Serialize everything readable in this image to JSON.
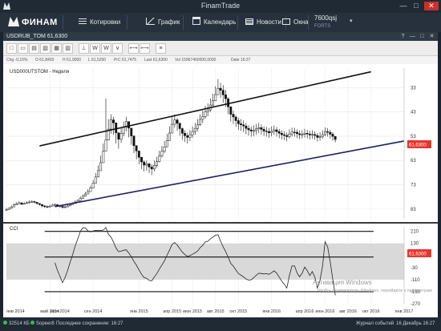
{
  "window": {
    "title": "FinamTrade",
    "minimize": "—",
    "maximize": "□",
    "close": "✕"
  },
  "toolbar": {
    "logo": "ФИНАМ",
    "items": [
      {
        "label": "Котировки",
        "icon": "quotes-icon"
      },
      {
        "label": "График",
        "icon": "chart-icon"
      },
      {
        "label": "Календарь",
        "icon": "calendar-icon"
      },
      {
        "label": "Новости",
        "icon": "news-icon"
      },
      {
        "label": "Окна",
        "icon": "windows-icon"
      }
    ],
    "account": {
      "id": "7600qsj",
      "sub": "FORTS"
    }
  },
  "chart_window": {
    "title": "USDRUB_TOM 61,6300",
    "buttons": [
      "?",
      "—",
      "□",
      "✕"
    ]
  },
  "chart_toolbar": {
    "buttons": [
      "□",
      "▭",
      "▤",
      "▧",
      "▦",
      "▥",
      "⊥",
      "W",
      "W",
      "∨",
      "⟷",
      "⟷",
      "≡"
    ]
  },
  "info_bar": {
    "chg": {
      "label": "Chg",
      "value": "-0,15%"
    },
    "open": {
      "label": "O",
      "value": "61,8400"
    },
    "high": {
      "label": "H",
      "value": "61,9000"
    },
    "low": {
      "label": "L",
      "value": "61,5250"
    },
    "prc": {
      "label": "PrC",
      "value": "61,7475"
    },
    "last": {
      "label": "Last",
      "value": "61,6300"
    },
    "vol": {
      "label": "Vol",
      "value": "15967460000,0000"
    },
    "date": {
      "label": "Date",
      "value": "16:27"
    }
  },
  "price_pane": {
    "legend": "USD000UTSTOM - Неделя",
    "y_ticks": [
      "83",
      "73",
      "63",
      "53",
      "43",
      "33"
    ],
    "last_price": "61,6300",
    "last_price_color": "#e8352c"
  },
  "cci_pane": {
    "label": "CCI",
    "y_ticks": [
      "210",
      "130",
      "50",
      "-30",
      "-110",
      "-190",
      "-270"
    ],
    "last_value": "61,6300"
  },
  "x_axis": {
    "labels": [
      "янв 2014",
      "май 2014",
      "июл 2014",
      "сен 2014",
      "янв 2015",
      "апр 2015",
      "июн 2015",
      "авг 2015",
      "окт 2015",
      "янв 2016",
      "апр 2016",
      "июн 2016",
      "авг 2016",
      "окт 2016",
      "янв 2017"
    ]
  },
  "watermark": {
    "line1": "Активация Windows",
    "line2": "Чтобы активировать Windows, перейдите к параметрам"
  },
  "status": {
    "memory": "32514 КБ",
    "connection": "Sopeer8",
    "saved": "Последнее сохранение: 16:27",
    "events": "Журнал событий",
    "datetime": "16 Декабрь 16:27"
  },
  "chart_data": [
    {
      "type": "candlestick",
      "title": "USD000UTSTOM - Неделя",
      "y_range": [
        29,
        91
      ],
      "x_range": [
        0,
        156
      ],
      "y_ticks": [
        33,
        43,
        53,
        63,
        73,
        83
      ],
      "x_tick_positions": [
        0,
        17,
        21,
        34,
        52,
        65,
        73,
        82,
        91,
        104,
        117,
        125,
        134,
        143,
        156
      ],
      "x_labels": [
        "янв 2014",
        "май 2014",
        "июл 2014",
        "сен 2014",
        "янв 2015",
        "апр 2015",
        "июн 2015",
        "авг 2015",
        "окт 2015",
        "янв 2016",
        "апр 2016",
        "июн 2016",
        "авг 2016",
        "окт 2016",
        "янв 2017"
      ],
      "close": [
        32.8,
        33.3,
        33.9,
        34.7,
        35.2,
        35.6,
        35.0,
        35.3,
        35.6,
        35.9,
        36.1,
        35.8,
        35.3,
        34.9,
        34.3,
        34.0,
        33.9,
        34.2,
        34.6,
        34.8,
        34.4,
        34.1,
        33.7,
        33.9,
        34.3,
        34.8,
        35.3,
        35.9,
        36.5,
        37.4,
        38.3,
        39.2,
        40.2,
        41.6,
        43.6,
        46.2,
        48.8,
        52.1,
        56.8,
        61.4,
        65.9,
        69.7,
        68.5,
        64.4,
        61.7,
        64.1,
        66.8,
        69.0,
        66.3,
        63.1,
        59.1,
        56.9,
        54.3,
        52.4,
        51.1,
        51.6,
        50.3,
        49.5,
        51.0,
        52.5,
        54.9,
        56.8,
        58.6,
        61.2,
        64.3,
        67.9,
        69.7,
        68.3,
        66.1,
        64.2,
        63.2,
        62.5,
        63.6,
        64.9,
        66.2,
        67.7,
        69.9,
        71.1,
        73.0,
        73.8,
        75.8,
        77.6,
        80.1,
        82.7,
        81.9,
        80.0,
        78.4,
        75.1,
        72.0,
        70.9,
        69.4,
        68.1,
        67.7,
        67.2,
        66.2,
        65.6,
        65.1,
        65.3,
        66.0,
        66.5,
        65.8,
        65.1,
        64.9,
        64.4,
        65.0,
        65.6,
        64.9,
        64.2,
        63.6,
        63.3,
        62.8,
        63.9,
        64.7,
        64.6,
        64.0,
        63.6,
        63.8,
        64.2,
        63.9,
        63.5,
        63.7,
        63.3,
        62.5,
        62.8,
        63.6,
        64.9,
        64.6,
        63.8,
        62.9,
        61.63
      ],
      "high": [
        33.5,
        33.8,
        34.5,
        35.3,
        35.8,
        36.1,
        35.6,
        35.8,
        36.2,
        36.6,
        36.7,
        36.4,
        35.9,
        35.5,
        34.9,
        34.6,
        34.5,
        34.8,
        35.2,
        35.4,
        35.0,
        34.7,
        34.3,
        34.5,
        34.9,
        35.4,
        35.9,
        36.5,
        37.2,
        38.2,
        39.1,
        40.1,
        41.2,
        42.6,
        45.0,
        47.8,
        51.0,
        55.0,
        60.0,
        78.5,
        70.0,
        72.0,
        71.0,
        67.0,
        64.5,
        66.5,
        69.0,
        71.0,
        68.5,
        65.5,
        61.5,
        59.0,
        56.5,
        54.5,
        53.0,
        53.0,
        52.0,
        51.5,
        53.0,
        54.5,
        57.0,
        59.0,
        61.0,
        64.0,
        67.0,
        71.0,
        72.0,
        70.5,
        68.5,
        66.5,
        65.5,
        64.5,
        65.5,
        67.0,
        68.5,
        70.0,
        72.0,
        73.5,
        75.5,
        76.5,
        78.5,
        80.5,
        83.5,
        86.5,
        85.0,
        84.0,
        82.0,
        79.0,
        75.0,
        73.5,
        71.5,
        70.5,
        70.0,
        69.5,
        68.5,
        67.5,
        67.0,
        67.5,
        68.0,
        68.5,
        67.8,
        67.0,
        66.8,
        66.4,
        67.0,
        67.4,
        66.8,
        66.0,
        65.4,
        65.0,
        64.5,
        65.8,
        66.5,
        66.4,
        65.8,
        65.4,
        65.5,
        66.0,
        65.6,
        65.2,
        65.4,
        65.0,
        64.2,
        64.6,
        65.4,
        66.6,
        66.3,
        65.6,
        64.6,
        63.0
      ],
      "low": [
        32.5,
        32.9,
        33.5,
        34.3,
        34.8,
        35.1,
        34.6,
        34.9,
        35.2,
        35.4,
        35.6,
        35.3,
        34.8,
        34.4,
        33.8,
        33.5,
        33.4,
        33.7,
        34.1,
        34.3,
        33.9,
        33.6,
        33.2,
        33.4,
        33.8,
        34.3,
        34.8,
        35.4,
        36.0,
        36.8,
        37.7,
        38.6,
        39.5,
        40.8,
        42.6,
        44.8,
        47.0,
        49.9,
        53.8,
        58.0,
        61.2,
        64.0,
        63.5,
        60.0,
        57.8,
        60.2,
        63.0,
        65.0,
        62.5,
        59.5,
        56.0,
        53.5,
        51.5,
        49.5,
        48.5,
        48.8,
        47.8,
        47.0,
        48.5,
        50.0,
        52.2,
        54.2,
        56.0,
        58.5,
        61.5,
        64.8,
        66.5,
        65.2,
        63.2,
        61.5,
        60.6,
        60.0,
        61.0,
        62.3,
        63.6,
        65.0,
        67.2,
        68.4,
        70.2,
        71.2,
        73.0,
        75.0,
        77.4,
        80.0,
        78.8,
        76.8,
        75.0,
        72.0,
        69.0,
        68.0,
        66.8,
        65.6,
        65.2,
        64.8,
        63.8,
        63.2,
        62.8,
        63.0,
        63.6,
        64.2,
        63.6,
        63.0,
        62.8,
        62.3,
        62.9,
        63.5,
        62.8,
        62.2,
        61.7,
        61.4,
        60.9,
        62.0,
        62.9,
        62.8,
        62.2,
        61.8,
        62.0,
        62.4,
        62.1,
        61.7,
        61.9,
        61.5,
        60.8,
        61.1,
        61.9,
        63.1,
        62.8,
        62.0,
        61.1,
        60.4
      ],
      "trendlines": [
        {
          "points": [
            [
              19,
              34.0
            ],
            [
              156,
              61.0
            ]
          ],
          "color": "#1e1e66"
        },
        {
          "points": [
            [
              13,
              59.0
            ],
            [
              143,
              89.5
            ]
          ],
          "color": "#111111"
        }
      ]
    },
    {
      "type": "line",
      "title": "CCI",
      "y_range": [
        -270,
        240
      ],
      "y_ticks": [
        210,
        130,
        50,
        -30,
        -110,
        -190,
        -270
      ],
      "band": [
        -110,
        130
      ],
      "hlines": [
        210,
        40,
        -190
      ],
      "values": [
        null,
        null,
        null,
        null,
        null,
        null,
        null,
        null,
        null,
        null,
        null,
        null,
        null,
        null,
        null,
        null,
        null,
        null,
        null,
        null,
        null,
        null,
        null,
        null,
        null,
        null,
        null,
        null,
        null,
        null,
        null,
        null,
        null,
        null,
        null,
        null,
        null,
        null,
        null,
        null,
        null,
        null,
        null,
        null,
        null,
        null,
        null,
        null,
        null,
        null,
        null,
        null,
        null,
        null,
        null,
        null,
        null,
        null,
        null,
        null,
        null,
        null,
        null,
        null,
        null,
        null,
        null,
        null,
        null,
        null,
        null,
        null,
        null,
        null,
        null,
        null,
        null,
        null,
        null,
        null,
        null,
        null,
        null,
        null,
        null,
        null,
        null,
        null,
        null,
        null,
        null,
        null,
        null,
        null,
        null,
        null,
        null,
        null,
        null,
        null,
        null,
        null,
        null,
        null,
        null,
        null,
        null,
        null,
        null,
        null,
        null,
        null,
        null,
        null,
        null,
        null,
        null,
        null,
        null,
        null,
        null,
        null,
        null,
        null,
        null,
        null,
        null,
        null,
        null,
        null
      ]
    }
  ]
}
